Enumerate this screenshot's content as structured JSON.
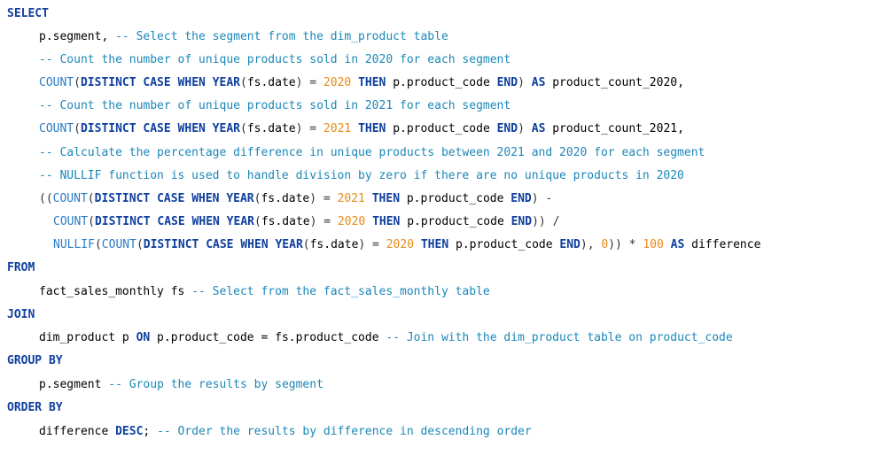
{
  "editor": {
    "language": "SQL",
    "colors": {
      "keyword": "#0f3f9e",
      "function": "#2b7cc4",
      "number": "#e88a1a",
      "comment": "#1b87b8",
      "text": "#000000",
      "background": "#ffffff"
    },
    "lines": [
      [
        {
          "t": "kw",
          "v": "SELECT"
        }
      ],
      [
        {
          "t": "tx",
          "v": "p.segment, "
        },
        {
          "t": "cm",
          "v": "-- Select the segment from the dim_product table"
        }
      ],
      [
        {
          "t": "cm",
          "v": "-- Count the number of unique products sold in 2020 for each segment"
        }
      ],
      [
        {
          "t": "fn",
          "v": "COUNT"
        },
        {
          "t": "op",
          "v": "("
        },
        {
          "t": "kw",
          "v": "DISTINCT CASE WHEN YEAR"
        },
        {
          "t": "op",
          "v": "("
        },
        {
          "t": "tx",
          "v": "fs.date"
        },
        {
          "t": "op",
          "v": ") = "
        },
        {
          "t": "num",
          "v": "2020"
        },
        {
          "t": "tx",
          "v": " "
        },
        {
          "t": "kw",
          "v": "THEN"
        },
        {
          "t": "tx",
          "v": " p.product_code "
        },
        {
          "t": "kw",
          "v": "END"
        },
        {
          "t": "op",
          "v": ") "
        },
        {
          "t": "kw",
          "v": "AS"
        },
        {
          "t": "tx",
          "v": " product_count_2020,"
        }
      ],
      [
        {
          "t": "cm",
          "v": "-- Count the number of unique products sold in 2021 for each segment"
        }
      ],
      [
        {
          "t": "fn",
          "v": "COUNT"
        },
        {
          "t": "op",
          "v": "("
        },
        {
          "t": "kw",
          "v": "DISTINCT CASE WHEN YEAR"
        },
        {
          "t": "op",
          "v": "("
        },
        {
          "t": "tx",
          "v": "fs.date"
        },
        {
          "t": "op",
          "v": ") = "
        },
        {
          "t": "num",
          "v": "2021"
        },
        {
          "t": "tx",
          "v": " "
        },
        {
          "t": "kw",
          "v": "THEN"
        },
        {
          "t": "tx",
          "v": " p.product_code "
        },
        {
          "t": "kw",
          "v": "END"
        },
        {
          "t": "op",
          "v": ") "
        },
        {
          "t": "kw",
          "v": "AS"
        },
        {
          "t": "tx",
          "v": " product_count_2021,"
        }
      ],
      [
        {
          "t": "cm",
          "v": "-- Calculate the percentage difference in unique products between 2021 and 2020 for each segment"
        }
      ],
      [
        {
          "t": "cm",
          "v": "-- NULLIF function is used to handle division by zero if there are no unique products in 2020"
        }
      ],
      [
        {
          "t": "op",
          "v": "(("
        },
        {
          "t": "fn",
          "v": "COUNT"
        },
        {
          "t": "op",
          "v": "("
        },
        {
          "t": "kw",
          "v": "DISTINCT CASE WHEN YEAR"
        },
        {
          "t": "op",
          "v": "("
        },
        {
          "t": "tx",
          "v": "fs.date"
        },
        {
          "t": "op",
          "v": ") = "
        },
        {
          "t": "num",
          "v": "2021"
        },
        {
          "t": "tx",
          "v": " "
        },
        {
          "t": "kw",
          "v": "THEN"
        },
        {
          "t": "tx",
          "v": " p.product_code "
        },
        {
          "t": "kw",
          "v": "END"
        },
        {
          "t": "op",
          "v": ") -"
        }
      ],
      [
        {
          "t": "fn",
          "v": "COUNT"
        },
        {
          "t": "op",
          "v": "("
        },
        {
          "t": "kw",
          "v": "DISTINCT CASE WHEN YEAR"
        },
        {
          "t": "op",
          "v": "("
        },
        {
          "t": "tx",
          "v": "fs.date"
        },
        {
          "t": "op",
          "v": ") = "
        },
        {
          "t": "num",
          "v": "2020"
        },
        {
          "t": "tx",
          "v": " "
        },
        {
          "t": "kw",
          "v": "THEN"
        },
        {
          "t": "tx",
          "v": " p.product_code "
        },
        {
          "t": "kw",
          "v": "END"
        },
        {
          "t": "op",
          "v": ")) /"
        }
      ],
      [
        {
          "t": "fn",
          "v": "NULLIF"
        },
        {
          "t": "op",
          "v": "("
        },
        {
          "t": "fn",
          "v": "COUNT"
        },
        {
          "t": "op",
          "v": "("
        },
        {
          "t": "kw",
          "v": "DISTINCT CASE WHEN YEAR"
        },
        {
          "t": "op",
          "v": "("
        },
        {
          "t": "tx",
          "v": "fs.date"
        },
        {
          "t": "op",
          "v": ") = "
        },
        {
          "t": "num",
          "v": "2020"
        },
        {
          "t": "tx",
          "v": " "
        },
        {
          "t": "kw",
          "v": "THEN"
        },
        {
          "t": "tx",
          "v": " p.product_code "
        },
        {
          "t": "kw",
          "v": "END"
        },
        {
          "t": "op",
          "v": "), "
        },
        {
          "t": "num",
          "v": "0"
        },
        {
          "t": "op",
          "v": ")) * "
        },
        {
          "t": "num",
          "v": "100"
        },
        {
          "t": "tx",
          "v": " "
        },
        {
          "t": "kw",
          "v": "AS"
        },
        {
          "t": "tx",
          "v": " difference"
        }
      ],
      [
        {
          "t": "kw",
          "v": "FROM"
        }
      ],
      [
        {
          "t": "tx",
          "v": "fact_sales_monthly fs "
        },
        {
          "t": "cm",
          "v": "-- Select from the fact_sales_monthly table"
        }
      ],
      [
        {
          "t": "kw",
          "v": "JOIN"
        }
      ],
      [
        {
          "t": "tx",
          "v": "dim_product p "
        },
        {
          "t": "kw",
          "v": "ON"
        },
        {
          "t": "tx",
          "v": " p.product_code = fs.product_code "
        },
        {
          "t": "cm",
          "v": "-- Join with the dim_product table on product_code"
        }
      ],
      [
        {
          "t": "kw",
          "v": "GROUP BY"
        }
      ],
      [
        {
          "t": "tx",
          "v": "p.segment "
        },
        {
          "t": "cm",
          "v": "-- Group the results by segment"
        }
      ],
      [
        {
          "t": "kw",
          "v": "ORDER BY"
        }
      ],
      [
        {
          "t": "tx",
          "v": "difference "
        },
        {
          "t": "kw",
          "v": "DESC"
        },
        {
          "t": "tx",
          "v": "; "
        },
        {
          "t": "cm",
          "v": "-- Order the results by difference in descending order"
        }
      ]
    ]
  }
}
